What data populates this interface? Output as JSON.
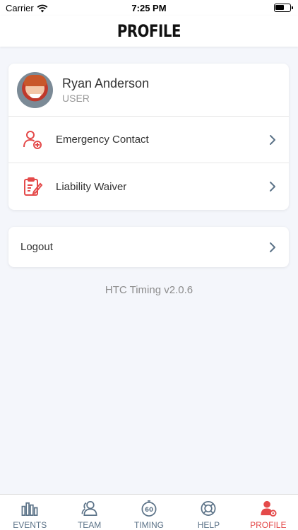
{
  "status_bar": {
    "carrier": "Carrier",
    "time": "7:25 PM"
  },
  "header": {
    "title": "PROFILE"
  },
  "profile": {
    "name": "Ryan Anderson",
    "role": "USER"
  },
  "menu": [
    {
      "label": "Emergency Contact",
      "icon": "user-plus-icon"
    },
    {
      "label": "Liability Waiver",
      "icon": "clipboard-edit-icon"
    }
  ],
  "logout": {
    "label": "Logout"
  },
  "version": "HTC Timing v2.0.6",
  "tabs": [
    {
      "label": "EVENTS",
      "icon": "bar-chart-icon",
      "active": false
    },
    {
      "label": "TEAM",
      "icon": "team-icon",
      "active": false
    },
    {
      "label": "TIMING",
      "icon": "stopwatch-icon",
      "active": false
    },
    {
      "label": "HELP",
      "icon": "lifebuoy-icon",
      "active": false
    },
    {
      "label": "PROFILE",
      "icon": "profile-icon",
      "active": true
    }
  ],
  "colors": {
    "accent": "#e44a4a",
    "tab_inactive": "#5c7388",
    "background": "#f4f6fb"
  }
}
